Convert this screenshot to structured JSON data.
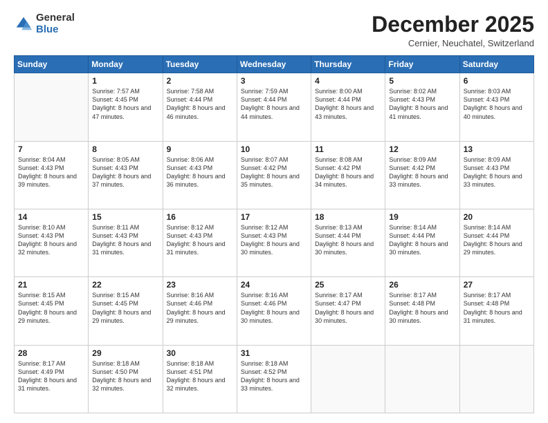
{
  "logo": {
    "general": "General",
    "blue": "Blue"
  },
  "header": {
    "month": "December 2025",
    "location": "Cernier, Neuchatel, Switzerland"
  },
  "weekdays": [
    "Sunday",
    "Monday",
    "Tuesday",
    "Wednesday",
    "Thursday",
    "Friday",
    "Saturday"
  ],
  "weeks": [
    [
      {
        "day": "",
        "sunrise": "",
        "sunset": "",
        "daylight": ""
      },
      {
        "day": "1",
        "sunrise": "7:57 AM",
        "sunset": "4:45 PM",
        "daylight": "8 hours and 47 minutes."
      },
      {
        "day": "2",
        "sunrise": "7:58 AM",
        "sunset": "4:44 PM",
        "daylight": "8 hours and 46 minutes."
      },
      {
        "day": "3",
        "sunrise": "7:59 AM",
        "sunset": "4:44 PM",
        "daylight": "8 hours and 44 minutes."
      },
      {
        "day": "4",
        "sunrise": "8:00 AM",
        "sunset": "4:44 PM",
        "daylight": "8 hours and 43 minutes."
      },
      {
        "day": "5",
        "sunrise": "8:02 AM",
        "sunset": "4:43 PM",
        "daylight": "8 hours and 41 minutes."
      },
      {
        "day": "6",
        "sunrise": "8:03 AM",
        "sunset": "4:43 PM",
        "daylight": "8 hours and 40 minutes."
      }
    ],
    [
      {
        "day": "7",
        "sunrise": "8:04 AM",
        "sunset": "4:43 PM",
        "daylight": "8 hours and 39 minutes."
      },
      {
        "day": "8",
        "sunrise": "8:05 AM",
        "sunset": "4:43 PM",
        "daylight": "8 hours and 37 minutes."
      },
      {
        "day": "9",
        "sunrise": "8:06 AM",
        "sunset": "4:43 PM",
        "daylight": "8 hours and 36 minutes."
      },
      {
        "day": "10",
        "sunrise": "8:07 AM",
        "sunset": "4:42 PM",
        "daylight": "8 hours and 35 minutes."
      },
      {
        "day": "11",
        "sunrise": "8:08 AM",
        "sunset": "4:42 PM",
        "daylight": "8 hours and 34 minutes."
      },
      {
        "day": "12",
        "sunrise": "8:09 AM",
        "sunset": "4:42 PM",
        "daylight": "8 hours and 33 minutes."
      },
      {
        "day": "13",
        "sunrise": "8:09 AM",
        "sunset": "4:43 PM",
        "daylight": "8 hours and 33 minutes."
      }
    ],
    [
      {
        "day": "14",
        "sunrise": "8:10 AM",
        "sunset": "4:43 PM",
        "daylight": "8 hours and 32 minutes."
      },
      {
        "day": "15",
        "sunrise": "8:11 AM",
        "sunset": "4:43 PM",
        "daylight": "8 hours and 31 minutes."
      },
      {
        "day": "16",
        "sunrise": "8:12 AM",
        "sunset": "4:43 PM",
        "daylight": "8 hours and 31 minutes."
      },
      {
        "day": "17",
        "sunrise": "8:12 AM",
        "sunset": "4:43 PM",
        "daylight": "8 hours and 30 minutes."
      },
      {
        "day": "18",
        "sunrise": "8:13 AM",
        "sunset": "4:44 PM",
        "daylight": "8 hours and 30 minutes."
      },
      {
        "day": "19",
        "sunrise": "8:14 AM",
        "sunset": "4:44 PM",
        "daylight": "8 hours and 30 minutes."
      },
      {
        "day": "20",
        "sunrise": "8:14 AM",
        "sunset": "4:44 PM",
        "daylight": "8 hours and 29 minutes."
      }
    ],
    [
      {
        "day": "21",
        "sunrise": "8:15 AM",
        "sunset": "4:45 PM",
        "daylight": "8 hours and 29 minutes."
      },
      {
        "day": "22",
        "sunrise": "8:15 AM",
        "sunset": "4:45 PM",
        "daylight": "8 hours and 29 minutes."
      },
      {
        "day": "23",
        "sunrise": "8:16 AM",
        "sunset": "4:46 PM",
        "daylight": "8 hours and 29 minutes."
      },
      {
        "day": "24",
        "sunrise": "8:16 AM",
        "sunset": "4:46 PM",
        "daylight": "8 hours and 30 minutes."
      },
      {
        "day": "25",
        "sunrise": "8:17 AM",
        "sunset": "4:47 PM",
        "daylight": "8 hours and 30 minutes."
      },
      {
        "day": "26",
        "sunrise": "8:17 AM",
        "sunset": "4:48 PM",
        "daylight": "8 hours and 30 minutes."
      },
      {
        "day": "27",
        "sunrise": "8:17 AM",
        "sunset": "4:48 PM",
        "daylight": "8 hours and 31 minutes."
      }
    ],
    [
      {
        "day": "28",
        "sunrise": "8:17 AM",
        "sunset": "4:49 PM",
        "daylight": "8 hours and 31 minutes."
      },
      {
        "day": "29",
        "sunrise": "8:18 AM",
        "sunset": "4:50 PM",
        "daylight": "8 hours and 32 minutes."
      },
      {
        "day": "30",
        "sunrise": "8:18 AM",
        "sunset": "4:51 PM",
        "daylight": "8 hours and 32 minutes."
      },
      {
        "day": "31",
        "sunrise": "8:18 AM",
        "sunset": "4:52 PM",
        "daylight": "8 hours and 33 minutes."
      },
      {
        "day": "",
        "sunrise": "",
        "sunset": "",
        "daylight": ""
      },
      {
        "day": "",
        "sunrise": "",
        "sunset": "",
        "daylight": ""
      },
      {
        "day": "",
        "sunrise": "",
        "sunset": "",
        "daylight": ""
      }
    ]
  ],
  "labels": {
    "sunrise": "Sunrise:",
    "sunset": "Sunset:",
    "daylight": "Daylight:"
  }
}
